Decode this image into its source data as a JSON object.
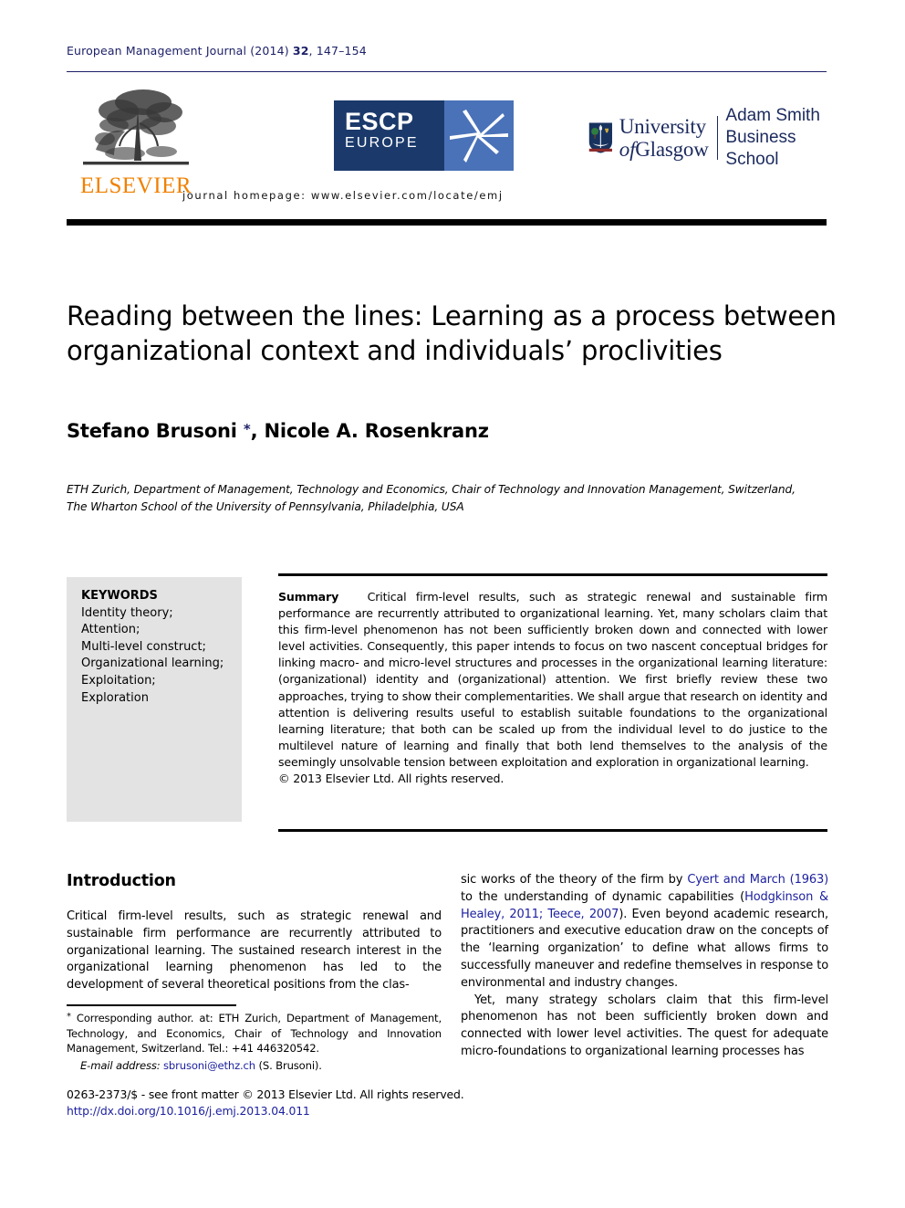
{
  "header": {
    "journal_name": "European Management Journal",
    "year": "(2014)",
    "volume": "32",
    "pages": ", 147–154",
    "homepage": "journal homepage: www.elsevier.com/locate/emj"
  },
  "logos": {
    "elsevier": {
      "name": "elsevier-logo",
      "wordmark": "ELSEVIER",
      "color": "#f08000"
    },
    "escp": {
      "name": "escp-europe-logo",
      "line1": "ESCP",
      "line2": "EUROPE",
      "dark_blue": "#1b3a6b",
      "light_blue": "#4a72b8"
    },
    "glasgow": {
      "name": "university-of-glasgow-logo",
      "line1": "University",
      "line2_italic": "of",
      "line2": "Glasgow",
      "school_line1": "Adam Smith",
      "school_line2": "Business School",
      "color": "#1b2a5e"
    }
  },
  "article": {
    "title": "Reading between the lines: Learning as a process between organizational context and individuals’ proclivities",
    "authors": "Stefano Brusoni ",
    "corresponding_marker": "*",
    "authors_rest": ", Nicole A. Rosenkranz",
    "affiliation_line1": "ETH Zurich, Department of Management, Technology and Economics, Chair of Technology and Innovation Management, Switzerland,",
    "affiliation_line2": "The Wharton School of the University of Pennsylvania, Philadelphia, USA"
  },
  "keywords": {
    "title": "KEYWORDS",
    "items": [
      "Identity theory;",
      "Attention;",
      "Multi-level construct;",
      "Organizational learning;",
      "Exploitation;",
      "Exploration"
    ]
  },
  "abstract": {
    "label": "Summary",
    "text": "Critical firm-level results, such as strategic renewal and sustainable firm performance are recurrently attributed to organizational learning. Yet, many scholars claim that this firm-level phenomenon has not been sufficiently broken down and connected with lower level activities. Consequently, this paper intends to focus on two nascent conceptual bridges for linking macro- and micro-level structures and processes in the organizational learning literature: (organizational) identity and (organizational) attention. We first briefly review these two approaches, trying to show their complementarities. We shall argue that research on identity and attention is delivering results useful to establish suitable foundations to the organizational learning literature; that both can be scaled up from the individual level to do justice to the multilevel nature of learning and finally that both lend themselves to the analysis of the seemingly unsolvable tension between exploitation and exploration in organizational learning.",
    "copyright": "© 2013 Elsevier Ltd. All rights reserved."
  },
  "body": {
    "section_heading": "Introduction",
    "left_paragraph": "Critical firm-level results, such as strategic renewal and sustainable firm performance are recurrently attributed to organizational learning. The sustained research interest in the organizational learning phenomenon has led to the development of several theoretical positions from the clas-",
    "right_p1_pre": "sic works of the theory of the firm by ",
    "right_p1_cite1": "Cyert and March (1963)",
    "right_p1_mid": " to the understanding of dynamic capabilities (",
    "right_p1_cite2": "Hodgkinson & Healey, 2011; Teece, 2007",
    "right_p1_post": "). Even beyond academic research, practitioners and executive education draw on the concepts of the ‘learning organization’ to define what allows firms to successfully maneuver and redefine themselves in response to environmental and industry changes.",
    "right_p2": "Yet, many strategy scholars claim that this firm-level phenomenon has not been sufficiently broken down and connected with lower level activities. The quest for adequate micro-foundations to organizational learning processes has"
  },
  "footnote": {
    "marker": "*",
    "text": " Corresponding author. at: ETH Zurich, Department of Management, Technology, and Economics, Chair of Technology and Innovation Management, Switzerland. Tel.: +41 446320542.",
    "email_label": "E-mail address:",
    "email": "sbrusoni@ethz.ch",
    "email_suffix": " (S. Brusoni)."
  },
  "bottom": {
    "front_matter": "0263-2373/$ - see front matter © 2013 Elsevier Ltd. All rights reserved.",
    "doi": "http://dx.doi.org/10.1016/j.emj.2013.04.011"
  }
}
